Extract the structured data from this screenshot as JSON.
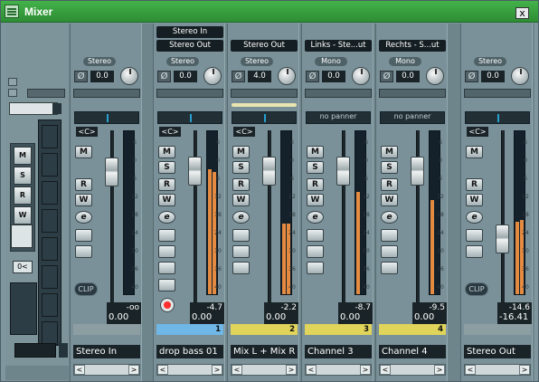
{
  "window": {
    "title": "Mixer",
    "close_label": "x"
  },
  "sidebar": {
    "input_tag": "0<",
    "buttons": [
      "M",
      "S",
      "R",
      "W"
    ]
  },
  "channels": [
    {
      "id": "stereo-in",
      "route_in": "",
      "route_out": "",
      "tag": "Stereo",
      "level": "0.0",
      "pan": "<C>",
      "peak_top": "-oo",
      "peak_bottom": "0.00",
      "number": "",
      "name": "Stereo In",
      "color": "#8d9ea3",
      "meter_left": 0,
      "meter_right": 0,
      "has_clip": true
    },
    {
      "id": "drop-bass-01",
      "route_in": "Stereo In",
      "route_out": "Stereo Out",
      "tag": "Stereo",
      "level": "0.0",
      "pan": "<C>",
      "peak_top": "-4.7",
      "peak_bottom": "0.00",
      "number": "1",
      "name": "drop bass 01",
      "color": "#6fb7e6",
      "meter_left": 0.76,
      "meter_right": 0.74,
      "has_clip": false
    },
    {
      "id": "mix-l-mix-r",
      "route_in": "",
      "route_out": "Stereo Out",
      "tag": "Stereo",
      "level": "4.0",
      "pan": "<C>",
      "peak_top": "-2.2",
      "peak_bottom": "0.00",
      "number": "2",
      "name": "Mix L + Mix R",
      "color": "#e0d45a",
      "meter_left": 0.43,
      "meter_right": 0.43,
      "has_clip": false
    },
    {
      "id": "channel-3",
      "route_in": "",
      "route_out": "Links - Ste...ut",
      "tag": "Mono",
      "level": "0.0",
      "pan": "no panner",
      "peak_top": "-8.7",
      "peak_bottom": "0.00",
      "number": "3",
      "name": "Channel 3",
      "color": "#e0d45a",
      "meter_left": 0.62,
      "meter_right": 0,
      "has_clip": false
    },
    {
      "id": "channel-4",
      "route_in": "",
      "route_out": "Rechts - S...ut",
      "tag": "Mono",
      "level": "0.0",
      "pan": "no panner",
      "peak_top": "-9.5",
      "peak_bottom": "0.00",
      "number": "4",
      "name": "Channel 4",
      "color": "#e0d45a",
      "meter_left": 0.57,
      "meter_right": 0,
      "has_clip": false
    },
    {
      "id": "stereo-out",
      "route_in": "",
      "route_out": "",
      "tag": "Stereo",
      "level": "0.0",
      "pan": "<C>",
      "peak_top": "-14.6",
      "peak_bottom": "-16.41",
      "number": "",
      "name": "Stereo Out",
      "color": "#8d9ea3",
      "meter_left": 0.44,
      "meter_right": 0.45,
      "has_clip": true
    }
  ],
  "strip_buttons": {
    "mute": "M",
    "solo": "S",
    "read": "R",
    "write": "W",
    "edit": "e"
  },
  "clip_label": "CLIP",
  "scale_ticks": [
    "6",
    "0",
    "6",
    "12",
    "18",
    "24",
    "30",
    "36",
    "40"
  ],
  "colors": {
    "title_green": "#3aa544",
    "accent_orange": "#e48a41",
    "pan_blue": "#27a0d0"
  }
}
